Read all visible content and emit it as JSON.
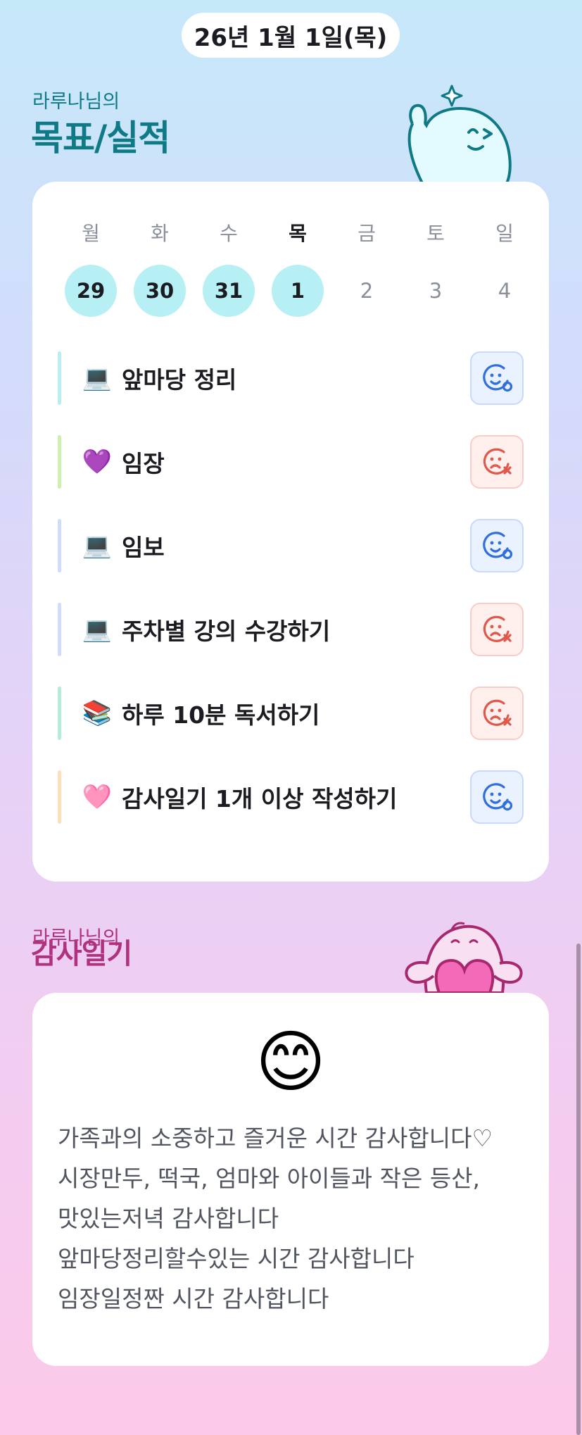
{
  "header": {
    "date": "26년 1월 1일(목)"
  },
  "goals_section": {
    "subtitle": "라루나님의",
    "title": "목표/실적"
  },
  "week": {
    "days": [
      {
        "name": "월",
        "date": "29",
        "state": "done",
        "today": false
      },
      {
        "name": "화",
        "date": "30",
        "state": "done",
        "today": false
      },
      {
        "name": "수",
        "date": "31",
        "state": "done",
        "today": false
      },
      {
        "name": "목",
        "date": "1",
        "state": "done",
        "today": true
      },
      {
        "name": "금",
        "date": "2",
        "state": "plain",
        "today": false
      },
      {
        "name": "토",
        "date": "3",
        "state": "plain",
        "today": false
      },
      {
        "name": "일",
        "date": "4",
        "state": "plain",
        "today": false
      }
    ]
  },
  "goals": [
    {
      "emoji": "💻",
      "label": "앞마당 정리",
      "bar_color": "#b9eef0",
      "status": "success",
      "status_icon": "smile-icon"
    },
    {
      "emoji": "💜",
      "label": "임장",
      "bar_color": "#cfeeb0",
      "status": "fail",
      "status_icon": "sad-icon"
    },
    {
      "emoji": "💻",
      "label": "임보",
      "bar_color": "#cfdcfb",
      "status": "success",
      "status_icon": "smile-icon"
    },
    {
      "emoji": "💻",
      "label": "주차별 강의 수강하기",
      "bar_color": "#cfdcfb",
      "status": "fail",
      "status_icon": "sad-icon"
    },
    {
      "emoji": "📚",
      "label": "하루 10분 독서하기",
      "bar_color": "#b5ecd8",
      "status": "fail",
      "status_icon": "sad-icon"
    },
    {
      "emoji": "🩷",
      "label": "감사일기 1개 이상 작성하기",
      "bar_color": "#fde0bd",
      "status": "success",
      "status_icon": "smile-icon"
    }
  ],
  "gratitude_section": {
    "subtitle": "라루나님의",
    "title": "감사일기"
  },
  "gratitude": {
    "emoji": "😊",
    "lines": [
      "가족과의 소중하고 즐거운 시간 감사합니다♡",
      "시장만두, 떡국, 엄마와 아이들과 작은 등산,",
      "맛있는저녁 감사합니다",
      "앞마당정리할수있는 시간 감사합니다",
      "임장일정짠 시간 감사합니다"
    ]
  },
  "colors": {
    "accent_teal": "#0e7a86",
    "accent_magenta": "#b0317e",
    "success_blue": "#2f6fe0",
    "fail_red": "#e0584a"
  }
}
